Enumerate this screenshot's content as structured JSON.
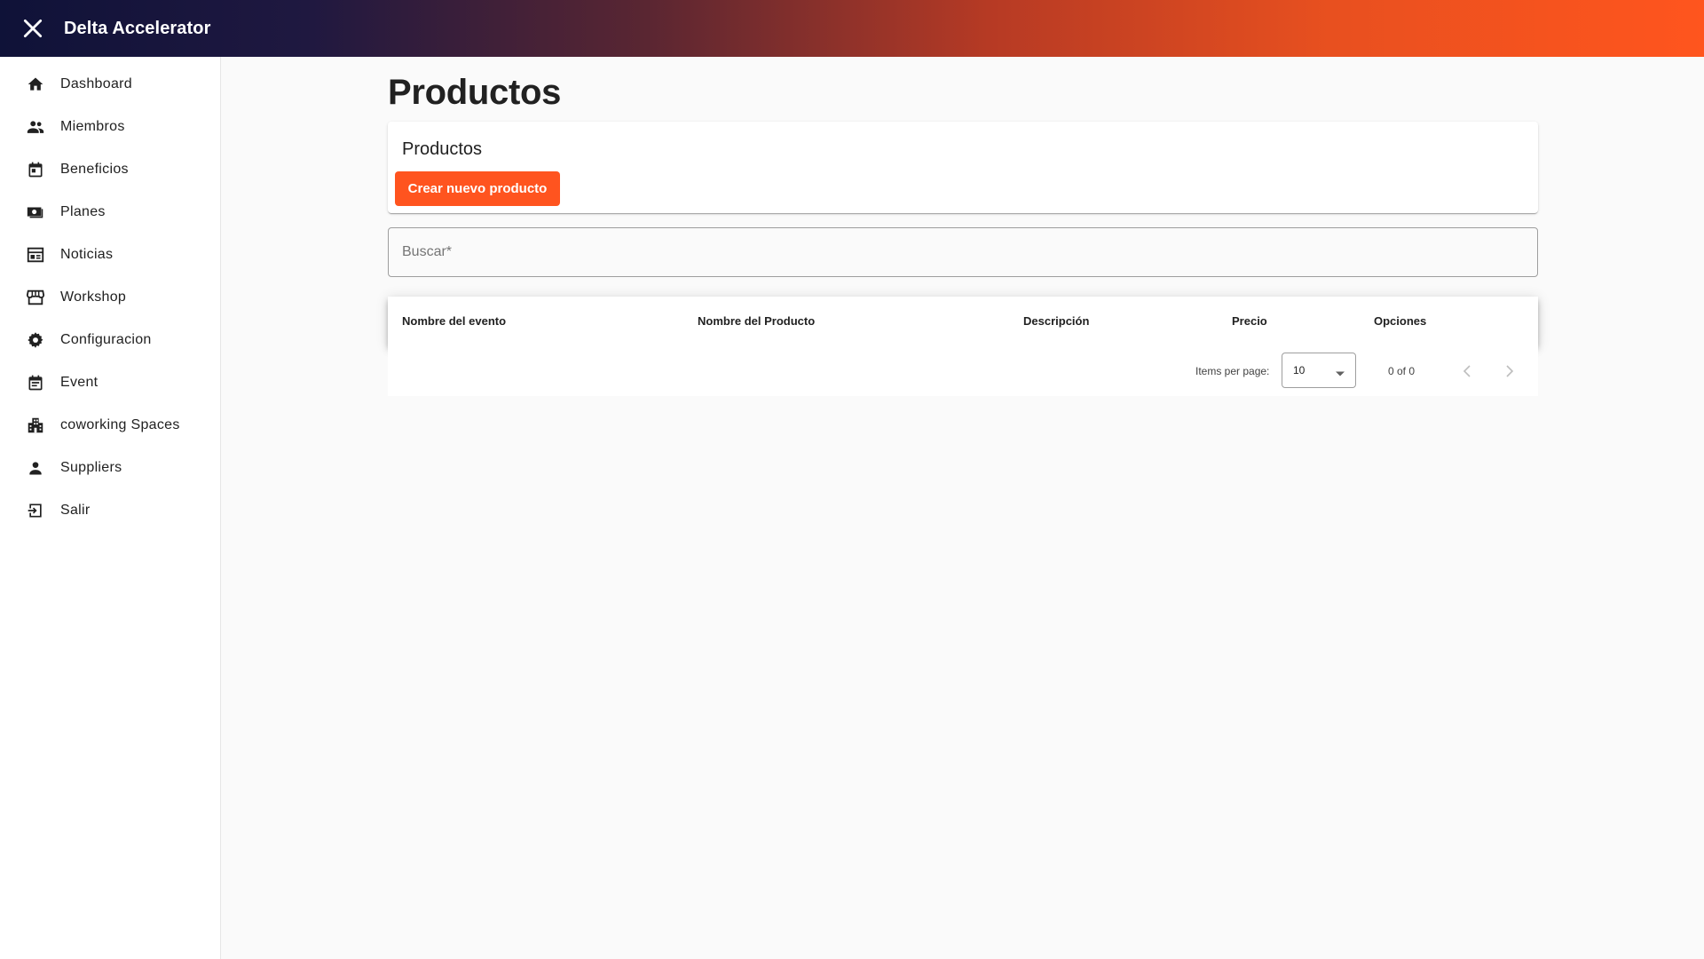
{
  "header": {
    "title": "Delta Accelerator"
  },
  "sidebar": {
    "items": [
      {
        "label": "Dashboard",
        "icon": "home-icon"
      },
      {
        "label": "Miembros",
        "icon": "people-icon"
      },
      {
        "label": "Beneficios",
        "icon": "calendar-icon"
      },
      {
        "label": "Planes",
        "icon": "payments-icon"
      },
      {
        "label": "Noticias",
        "icon": "newspaper-icon"
      },
      {
        "label": "Workshop",
        "icon": "storefront-icon"
      },
      {
        "label": "Configuracion",
        "icon": "gear-icon"
      },
      {
        "label": "Event",
        "icon": "event-note-icon"
      },
      {
        "label": "coworking Spaces",
        "icon": "building-icon"
      },
      {
        "label": "Suppliers",
        "icon": "person-icon"
      },
      {
        "label": "Salir",
        "icon": "logout-icon"
      }
    ]
  },
  "main": {
    "title": "Productos",
    "card": {
      "title": "Productos",
      "create_label": "Crear nuevo producto"
    },
    "search": {
      "placeholder": "Buscar*",
      "value": ""
    },
    "table": {
      "columns": [
        "Nombre del evento",
        "Nombre del Producto",
        "Descripción",
        "Precio",
        "Opciones"
      ],
      "rows": []
    },
    "paginator": {
      "items_per_page_label": "Items per page:",
      "page_size": "10",
      "range": "0 of 0"
    }
  },
  "colors": {
    "accent": "#ff541f",
    "topbar_start": "#0f1238",
    "topbar_end": "#ff551e"
  }
}
